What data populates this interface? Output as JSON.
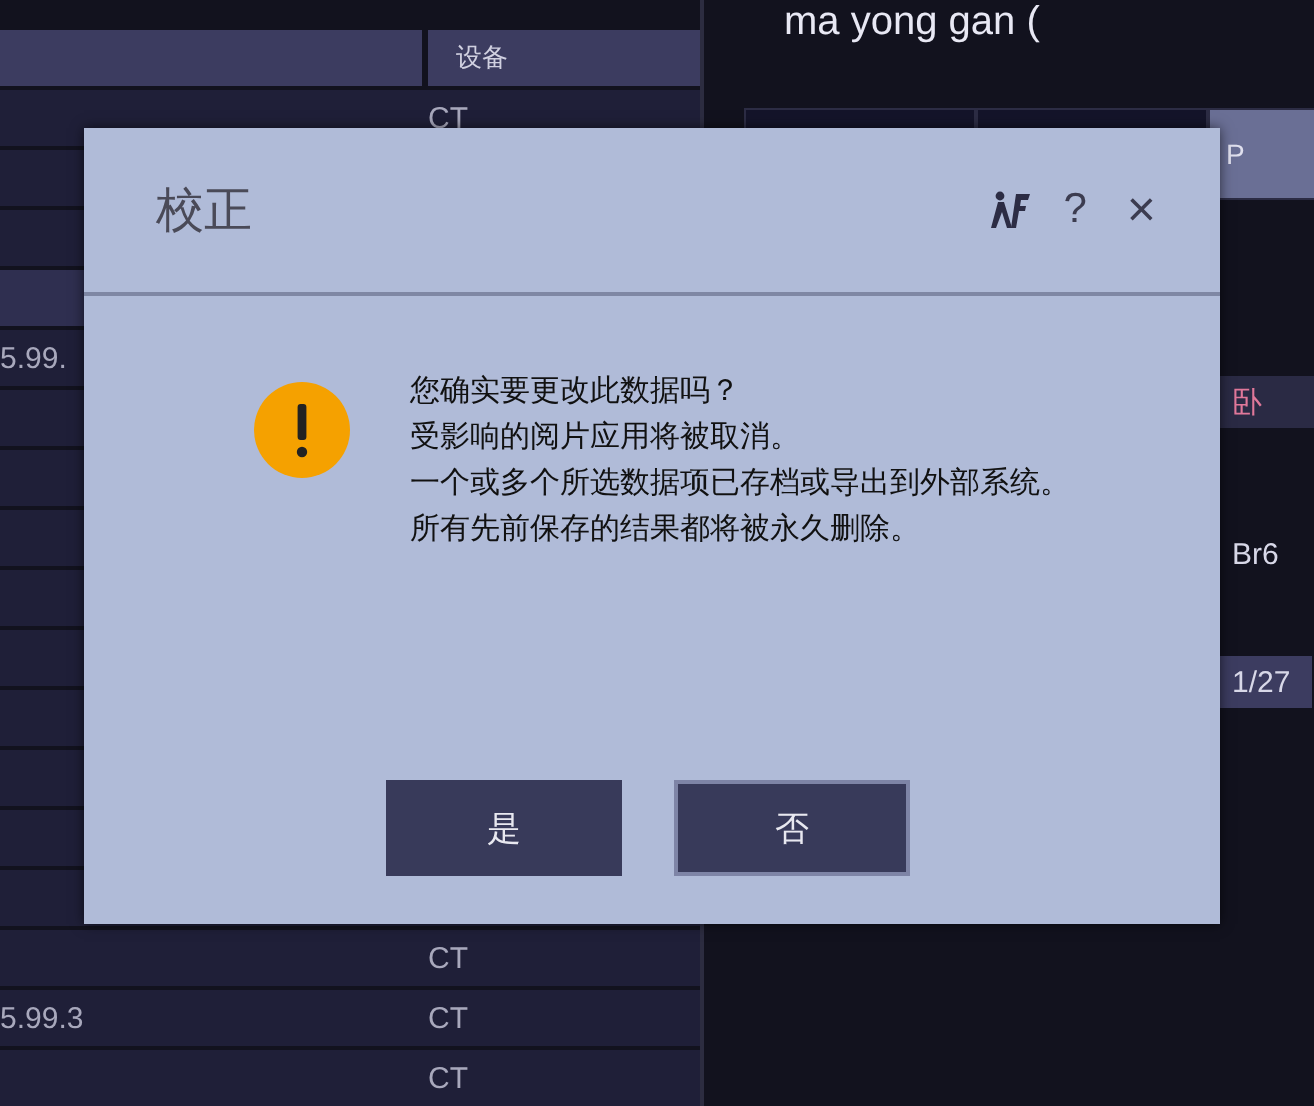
{
  "background": {
    "table": {
      "columns": [
        {
          "label": "设备"
        }
      ],
      "rows": [
        {
          "device": "CT",
          "selected": false
        },
        {
          "selected": false
        },
        {
          "selected": false
        },
        {
          "selected": true
        },
        {
          "selected": false,
          "column_1": "5.99."
        },
        {
          "selected": false
        },
        {
          "selected": false
        },
        {
          "selected": false
        },
        {
          "selected": false
        },
        {
          "selected": false
        },
        {
          "selected": false
        },
        {
          "selected": false
        },
        {
          "selected": false
        },
        {
          "selected": false
        },
        {
          "device": "CT",
          "selected": false
        },
        {
          "column_1": "5.99.3",
          "device": "CT",
          "selected": false
        },
        {
          "device": "CT",
          "selected": false
        }
      ]
    },
    "panel": {
      "title": "ma yong gan (",
      "tabs": [
        {
          "selected": false
        },
        {
          "selected": false
        },
        {
          "label": "P",
          "selected": true
        }
      ],
      "cells": [
        {
          "text": "卧",
          "kind": "highlight"
        },
        {
          "text": "Br6",
          "kind": "plain"
        },
        {
          "text": "1/27",
          "kind": "badge"
        }
      ]
    }
  },
  "dialog": {
    "title": "校正",
    "help": "?",
    "close": "×",
    "message": [
      "您确实要更改此数据吗？",
      "受影响的阅片应用将被取消。",
      "一个或多个所选数据项已存档或导出到外部系统。",
      "所有先前保存的结果都将被永久删除。"
    ],
    "buttons": [
      {
        "label": "是",
        "focused": false
      },
      {
        "label": "否",
        "focused": true
      }
    ]
  }
}
